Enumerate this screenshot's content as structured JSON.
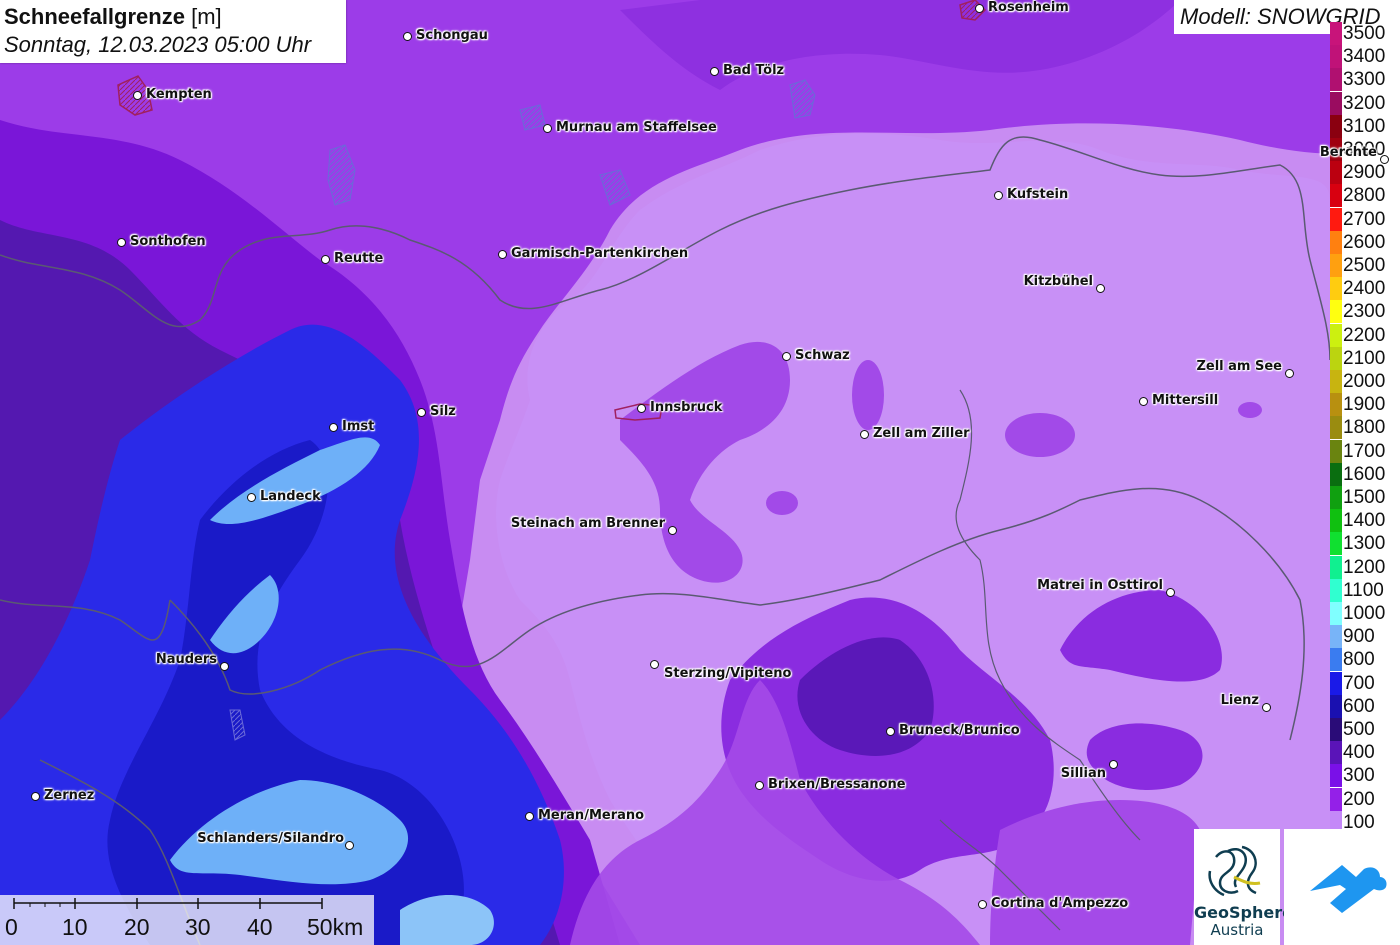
{
  "title": {
    "main": "Schneefallgrenze",
    "unit": "[m]",
    "date": "Sonntag, 12.03.2023 05:00 Uhr"
  },
  "model": {
    "label": "Modell: SNOWGRID"
  },
  "legend": {
    "entries": [
      {
        "label": "3500",
        "color": "#c8147a"
      },
      {
        "label": "3400",
        "color": "#c01278"
      },
      {
        "label": "3300",
        "color": "#b01070"
      },
      {
        "label": "3200",
        "color": "#9a0c60"
      },
      {
        "label": "3100",
        "color": "#8a0010"
      },
      {
        "label": "3000",
        "color": "#a00010"
      },
      {
        "label": "2900",
        "color": "#bb0010"
      },
      {
        "label": "2800",
        "color": "#d80010"
      },
      {
        "label": "2700",
        "color": "#ff1a10"
      },
      {
        "label": "2600",
        "color": "#ff8010"
      },
      {
        "label": "2500",
        "color": "#ffa010"
      },
      {
        "label": "2400",
        "color": "#ffcc10"
      },
      {
        "label": "2300",
        "color": "#ffff10"
      },
      {
        "label": "2200",
        "color": "#ccf010"
      },
      {
        "label": "2100",
        "color": "#bbd410"
      },
      {
        "label": "2000",
        "color": "#c8b410"
      },
      {
        "label": "1900",
        "color": "#b89010"
      },
      {
        "label": "1800",
        "color": "#9a8c10"
      },
      {
        "label": "1700",
        "color": "#6a8410"
      },
      {
        "label": "1600",
        "color": "#0a6e10"
      },
      {
        "label": "1500",
        "color": "#10a010"
      },
      {
        "label": "1400",
        "color": "#10c010"
      },
      {
        "label": "1300",
        "color": "#10e030"
      },
      {
        "label": "1200",
        "color": "#10f090"
      },
      {
        "label": "1100",
        "color": "#30ffd0"
      },
      {
        "label": "1000",
        "color": "#80ffff"
      },
      {
        "label": "900",
        "color": "#78b4f8"
      },
      {
        "label": "800",
        "color": "#3a7cf0"
      },
      {
        "label": "700",
        "color": "#1a1ae8"
      },
      {
        "label": "600",
        "color": "#1a10b0"
      },
      {
        "label": "500",
        "color": "#2a0c78"
      },
      {
        "label": "400",
        "color": "#5a14b8"
      },
      {
        "label": "300",
        "color": "#7a10e8"
      },
      {
        "label": "200",
        "color": "#9420e8"
      },
      {
        "label": "100",
        "color": "#c488f8"
      }
    ]
  },
  "cities": [
    {
      "name": "Rosenheim"
    },
    {
      "name": "Schongau"
    },
    {
      "name": "Kempten"
    },
    {
      "name": "Bad Tölz"
    },
    {
      "name": "Murnau am Staffelsee"
    },
    {
      "name": "Berchte"
    },
    {
      "name": "Kufstein"
    },
    {
      "name": "Sonthofen"
    },
    {
      "name": "Reutte"
    },
    {
      "name": "Garmisch-Partenkirchen"
    },
    {
      "name": "Kitzbühel"
    },
    {
      "name": "Schwaz"
    },
    {
      "name": "Zell am See"
    },
    {
      "name": "Mittersill"
    },
    {
      "name": "Silz"
    },
    {
      "name": "Imst"
    },
    {
      "name": "Innsbruck"
    },
    {
      "name": "Zell am Ziller"
    },
    {
      "name": "Landeck"
    },
    {
      "name": "Steinach am Brenner"
    },
    {
      "name": "Matrei in Osttirol"
    },
    {
      "name": "Nauders"
    },
    {
      "name": "Sterzing/Vipiteno"
    },
    {
      "name": "Lienz"
    },
    {
      "name": "Bruneck/Brunico"
    },
    {
      "name": "Sillian"
    },
    {
      "name": "Brixen/Bressanone"
    },
    {
      "name": "Zernez"
    },
    {
      "name": "Meran/Merano"
    },
    {
      "name": "Schlanders/Silandro"
    },
    {
      "name": "Cortina d'Ampezzo"
    }
  ],
  "scalebar": {
    "labels": [
      "0",
      "10",
      "20",
      "30",
      "40",
      "50km"
    ]
  },
  "logos": {
    "geosphere_name": "GeoSphere",
    "geosphere_sub": "Austria"
  }
}
